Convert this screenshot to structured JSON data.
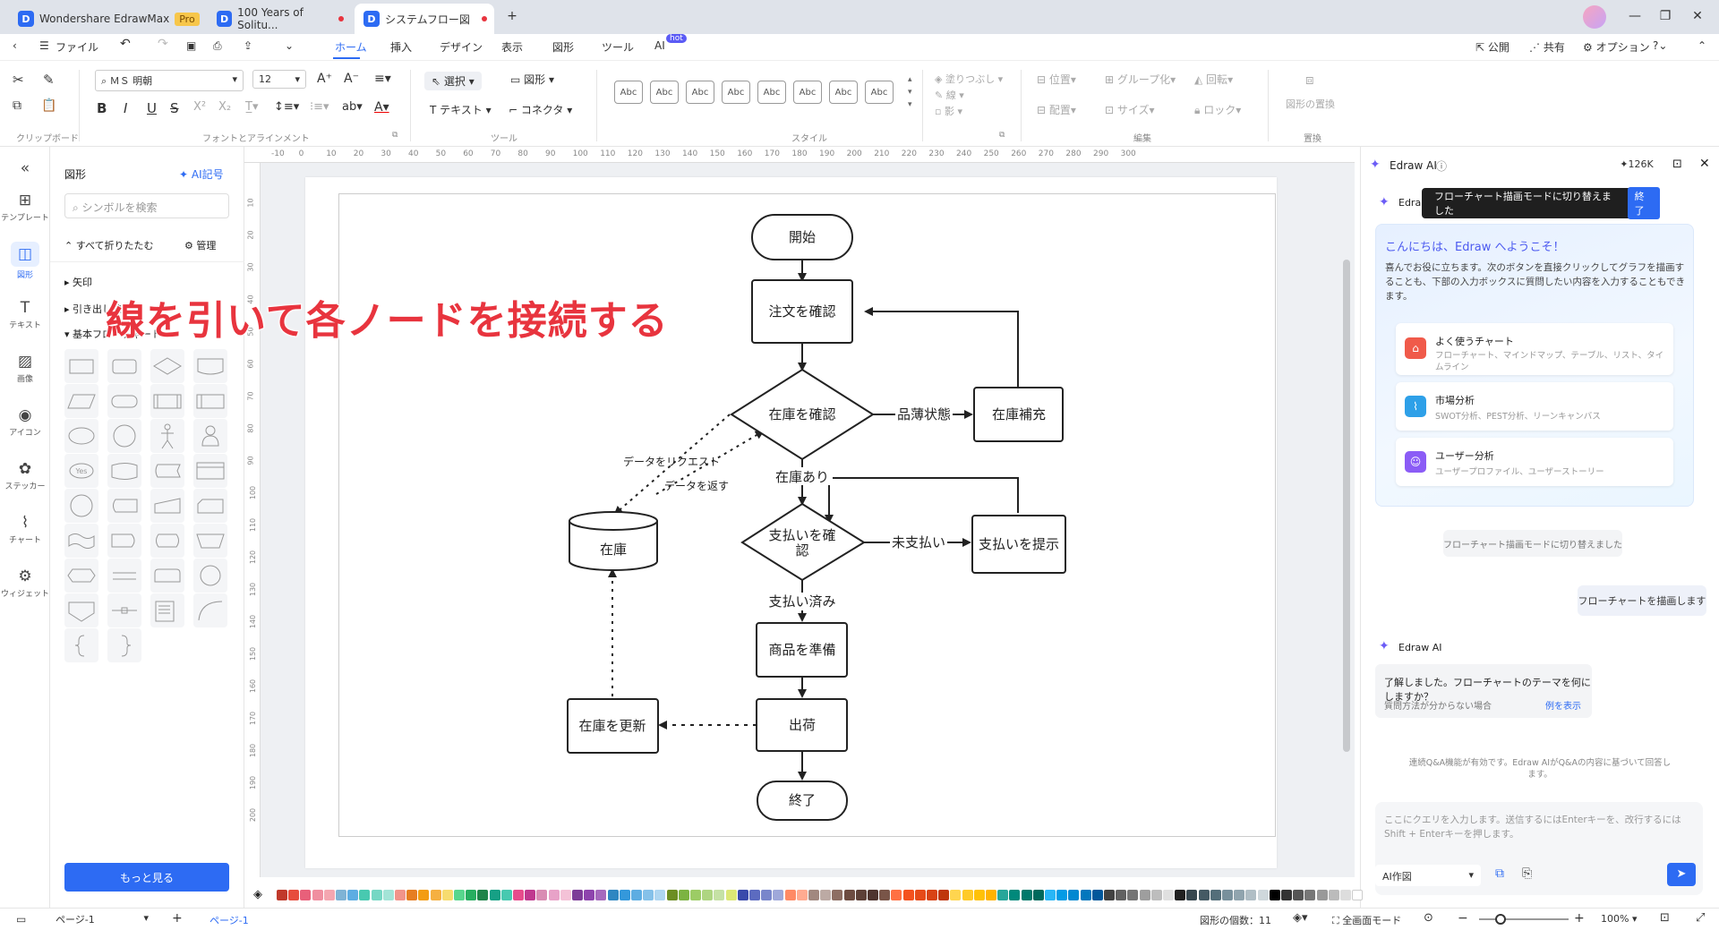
{
  "titlebar": {
    "tabs": [
      {
        "label": "Wondershare EdrawMax",
        "badge": "Pro"
      },
      {
        "label": "100 Years of Solitu..."
      },
      {
        "label": "システムフロー図"
      }
    ]
  },
  "menubar": {
    "file": "ファイル",
    "tabs": [
      "ホーム",
      "挿入",
      "デザイン",
      "表示",
      "図形",
      "ツール",
      "AI"
    ],
    "ai_badge": "hot",
    "right": [
      "公開",
      "共有",
      "オプション"
    ]
  },
  "ribbon": {
    "font_name": "ＭＳ 明朝",
    "font_size": "12",
    "select": "選択",
    "shape": "図形",
    "text": "テキスト",
    "connector": "コネクタ",
    "style_sample": "Abc",
    "fill": "塗りつぶし",
    "line": "線",
    "shadow": "影",
    "position": "位置",
    "align": "配置",
    "group": "グループ化",
    "size": "サイズ",
    "rotate": "回転",
    "lock": "ロック",
    "replace": "図形の置換",
    "groups": [
      "クリップボード",
      "フォントとアラインメント",
      "ツール",
      "スタイル",
      "編集",
      "置換"
    ]
  },
  "leftbar": {
    "items": [
      "テンプレート",
      "図形",
      "テキスト",
      "画像",
      "アイコン",
      "ステッカー",
      "チャート",
      "ウィジェット"
    ]
  },
  "shapepanel": {
    "title": "図形",
    "ai_link": "AI記号",
    "search_placeholder": "シンボルを検索",
    "collapse_all": "すべて折りたたむ",
    "manage": "管理",
    "categories": [
      "矢印",
      "引き出し線",
      "基本フローチャート"
    ],
    "more_button": "もっと見る"
  },
  "overlay_caption": "線を引いて各ノードを接続する",
  "ruler": {
    "h": [
      "-10",
      "0",
      "10",
      "20",
      "30",
      "40",
      "50",
      "60",
      "70",
      "80",
      "90",
      "100",
      "110",
      "120",
      "130",
      "140",
      "150",
      "160",
      "170",
      "180",
      "190",
      "200",
      "210",
      "220",
      "230",
      "240",
      "250",
      "260",
      "270",
      "280",
      "290",
      "300"
    ],
    "v": [
      "10",
      "20",
      "30",
      "40",
      "50",
      "60",
      "70",
      "80",
      "90",
      "100",
      "110",
      "120",
      "130",
      "140",
      "150",
      "160",
      "170",
      "180",
      "190",
      "200"
    ]
  },
  "flowchart": {
    "start": "開始",
    "check_order": "注文を確認",
    "check_stock": "在庫を確認",
    "shortage": "品薄状態",
    "restock": "在庫補充",
    "stock_db": "在庫",
    "data_request": "データをリクエスト",
    "data_return": "データを返す",
    "in_stock": "在庫あり",
    "check_payment_1": "支払いを確",
    "check_payment_2": "認",
    "unpaid": "未支払い",
    "show_payment": "支払いを提示",
    "paid": "支払い済み",
    "prepare": "商品を準備",
    "ship": "出荷",
    "update_stock": "在庫を更新",
    "end": "終了"
  },
  "rightpanel": {
    "title": "Edraw AI",
    "tokens": "126K",
    "toast": "フローチャート描画モードに切り替えました",
    "toast_button": "終了",
    "header_short": "Edra",
    "welcome_title": "こんにちは、Edraw へようこそ！",
    "welcome_body": "喜んでお役に立ちます。次のボタンを直接クリックしてグラフを描画することも、下部の入力ボックスに質問したい内容を入力することもできます。",
    "cards": [
      {
        "title": "よく使うチャート",
        "desc": "フローチャート、マインドマップ、テーブル、リスト、タイムライン"
      },
      {
        "title": "市場分析",
        "desc": "SWOT分析、PEST分析、リーンキャンバス"
      },
      {
        "title": "ユーザー分析",
        "desc": "ユーザープロファイル、ユーザーストーリー"
      }
    ],
    "system_msg": "フローチャート描画モードに切り替えました",
    "user_msg": "フローチャートを描画します",
    "ai_name": "Edraw AI",
    "ai_reply": "了解しました。フローチャートのテーマを何にしますか？",
    "ai_hint": "質問方法が分からない場合",
    "ai_example": "例を表示",
    "qa_note": "連続Q&A機能が有効です。Edraw AIがQ&Aの内容に基づいて回答します。",
    "input_placeholder": "ここにクエリを入力します。送信するにはEnterキーを、改行するにはShift + Enterキーを押します。",
    "mode_select": "AI作図"
  },
  "statusbar": {
    "page_select": "ページ-1",
    "page_tab": "ページ-1",
    "shape_count": "図形の個数：11",
    "fullscreen": "全画面モード",
    "zoom": "100%"
  },
  "colors": {
    "accent": "#2d6bf3",
    "caption": "#e8343e",
    "palette": [
      "#c0392b",
      "#e74c3c",
      "#e8607a",
      "#f08fa0",
      "#f4a6b0",
      "#7fb3d5",
      "#5dade2",
      "#48c9b0",
      "#76d7c4",
      "#a3e4d7",
      "#f1948a",
      "#e67e22",
      "#f39c12",
      "#f5b041",
      "#f7dc6f",
      "#58d68d",
      "#27ae60",
      "#1e8449",
      "#16a085",
      "#48c9b0",
      "#e74c8c",
      "#c0398f",
      "#d98cb3",
      "#e8a2c8",
      "#f4c2d7",
      "#7d3c98",
      "#8e44ad",
      "#a569bd",
      "#2e86c1",
      "#3498db",
      "#5dade2",
      "#85c1e9",
      "#aed6f1",
      "#6c8e23",
      "#7cb342",
      "#9ccc65",
      "#aed581",
      "#c5e1a5",
      "#dce775",
      "#3949ab",
      "#5c6bc0",
      "#7986cb",
      "#9fa8da",
      "#ff8a65",
      "#ffab91",
      "#a1887f",
      "#bcaaa4",
      "#8d6e63",
      "#6d4c41",
      "#5d4037",
      "#4e342e",
      "#795548",
      "#ff7043",
      "#f4511e",
      "#e64a19",
      "#d84315",
      "#bf360c",
      "#ffd54f",
      "#ffca28",
      "#ffc107",
      "#ffb300",
      "#26a69a",
      "#00897b",
      "#00796b",
      "#00695c",
      "#29b6f6",
      "#039be5",
      "#0288d1",
      "#0277bd",
      "#01579b",
      "#424242",
      "#616161",
      "#757575",
      "#9e9e9e",
      "#bdbdbd",
      "#e0e0e0",
      "#212121",
      "#37474f",
      "#455a64",
      "#546e7a",
      "#78909c",
      "#90a4ae",
      "#b0bec5",
      "#cfd8dc",
      "#000000",
      "#333333",
      "#555555",
      "#777777",
      "#999999",
      "#bbbbbb",
      "#dddddd",
      "#ffffff"
    ]
  }
}
